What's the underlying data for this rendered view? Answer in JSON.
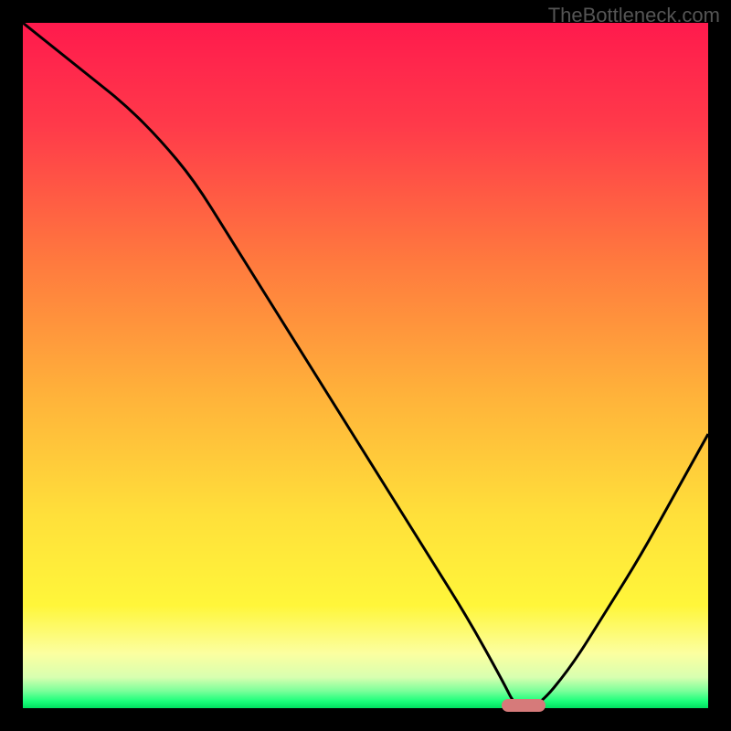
{
  "watermark": "TheBottleneck.com",
  "chart_data": {
    "type": "line",
    "title": "",
    "xlabel": "",
    "ylabel": "",
    "x": [
      0,
      5,
      10,
      15,
      20,
      25,
      30,
      35,
      40,
      45,
      50,
      55,
      60,
      65,
      70,
      72,
      75,
      80,
      85,
      90,
      95,
      100
    ],
    "values": [
      100,
      96,
      92,
      88,
      83,
      77,
      69,
      61,
      53,
      45,
      37,
      29,
      21,
      13,
      4,
      0,
      0,
      6,
      14,
      22,
      31,
      40
    ],
    "ylim": [
      0,
      100
    ],
    "xlim": [
      0,
      100
    ],
    "gradient_stops": [
      {
        "pos": 0.0,
        "color": "#ff1a4d"
      },
      {
        "pos": 0.15,
        "color": "#ff3a4a"
      },
      {
        "pos": 0.35,
        "color": "#ff7a3e"
      },
      {
        "pos": 0.55,
        "color": "#ffb43a"
      },
      {
        "pos": 0.72,
        "color": "#ffe03a"
      },
      {
        "pos": 0.85,
        "color": "#fff63a"
      },
      {
        "pos": 0.92,
        "color": "#fcffa0"
      },
      {
        "pos": 0.955,
        "color": "#d8ffb0"
      },
      {
        "pos": 0.975,
        "color": "#7aff9a"
      },
      {
        "pos": 0.99,
        "color": "#1aff7a"
      },
      {
        "pos": 1.0,
        "color": "#00e060"
      }
    ],
    "marker": {
      "x": 73,
      "y": 0
    }
  }
}
